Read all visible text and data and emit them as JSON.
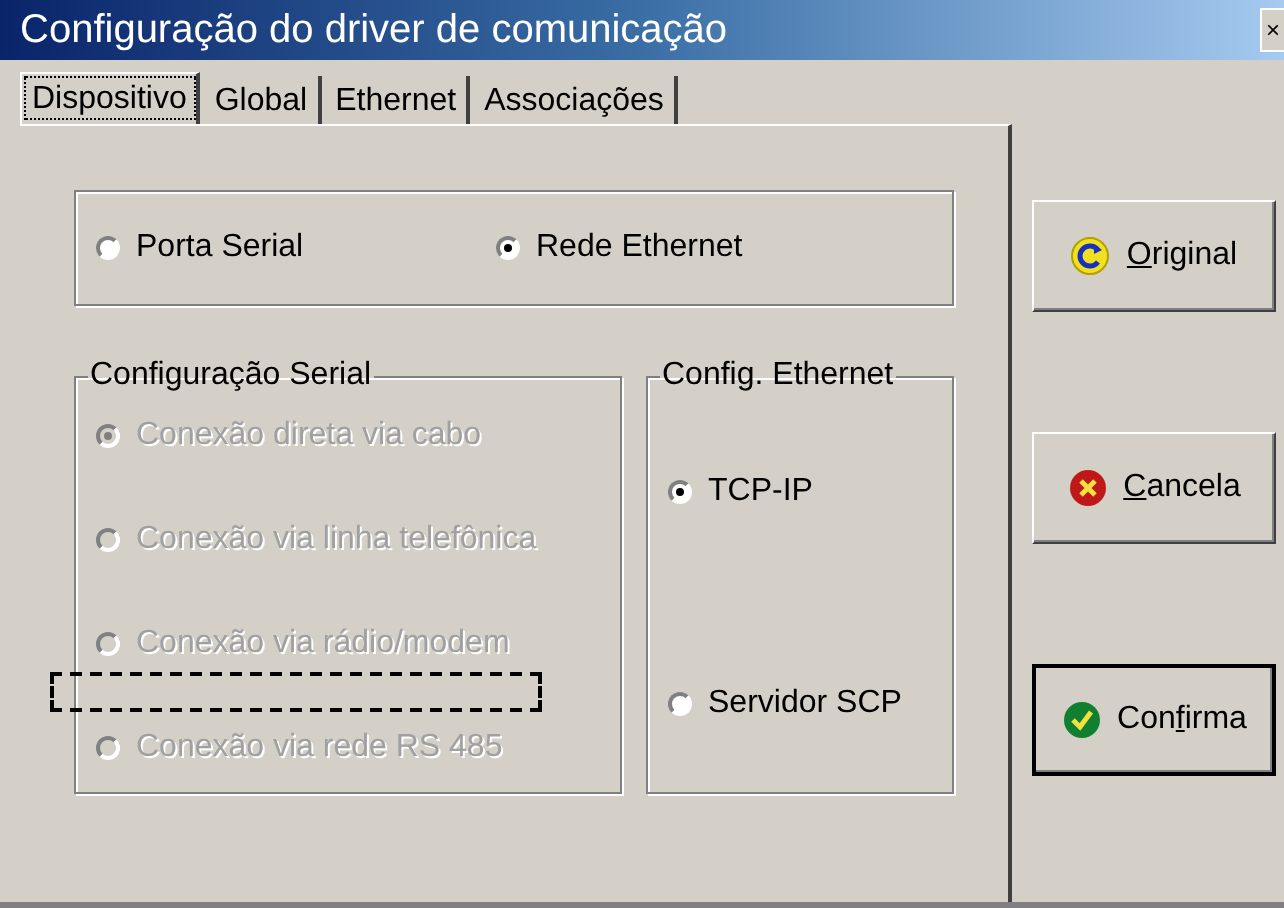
{
  "window": {
    "title": "Configuração do driver de comunicação",
    "close_glyph": "×"
  },
  "tabs": [
    {
      "label": "Dispositivo",
      "selected": true
    },
    {
      "label": "Global",
      "selected": false
    },
    {
      "label": "Ethernet",
      "selected": false
    },
    {
      "label": "Associações",
      "selected": false
    }
  ],
  "mode": [
    {
      "label": "Porta Serial",
      "checked": false,
      "disabled": false
    },
    {
      "label": "Rede Ethernet",
      "checked": true,
      "disabled": false
    }
  ],
  "serial_group": {
    "title": "Configuração Serial",
    "options": [
      {
        "label": "Conexão direta via cabo",
        "checked": true,
        "disabled": true
      },
      {
        "label": "Conexão via linha telefônica",
        "checked": false,
        "disabled": true
      },
      {
        "label": "Conexão via rádio/modem",
        "checked": false,
        "disabled": true
      },
      {
        "label": "Conexão via rede RS 485",
        "checked": false,
        "disabled": true
      }
    ]
  },
  "ethernet_group": {
    "title": "Config. Ethernet",
    "options": [
      {
        "label": "TCP-IP",
        "checked": true,
        "disabled": false
      },
      {
        "label": "Servidor SCP",
        "checked": false,
        "disabled": false
      }
    ]
  },
  "buttons": [
    {
      "kind": "refresh",
      "access_key": "O",
      "label_rest": "riginal",
      "default": false
    },
    {
      "kind": "cancel",
      "access_key": "C",
      "label_rest": "ancela",
      "default": false
    },
    {
      "kind": "confirm",
      "label_start": "Con",
      "access_key": "f",
      "label_rest": "irma",
      "default": true
    }
  ]
}
